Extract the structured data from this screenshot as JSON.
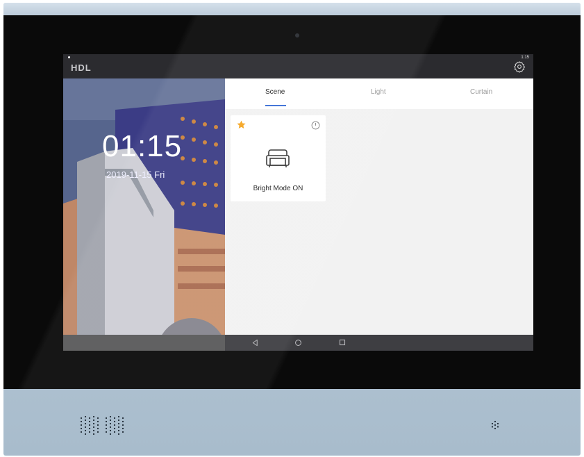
{
  "statusbar": {
    "brand": "HDL",
    "time": "1:15"
  },
  "home": {
    "clock": "01:15",
    "date": "2019-11-15 Fri"
  },
  "tabs": [
    {
      "label": "Scene",
      "active": true
    },
    {
      "label": "Light",
      "active": false
    },
    {
      "label": "Curtain",
      "active": false
    }
  ],
  "scenes": [
    {
      "label": "Bright Mode ON",
      "icon": "sofa-icon",
      "favorite": true,
      "timer": true
    }
  ],
  "navbar": {
    "icons": [
      "back-icon",
      "home-icon",
      "recent-apps-icon"
    ]
  },
  "colors": {
    "accent": "#3b6fd6",
    "favorite_star": "#f5a623",
    "device_frame": "#b7c8d8",
    "bezel": "#0a0a0a"
  }
}
